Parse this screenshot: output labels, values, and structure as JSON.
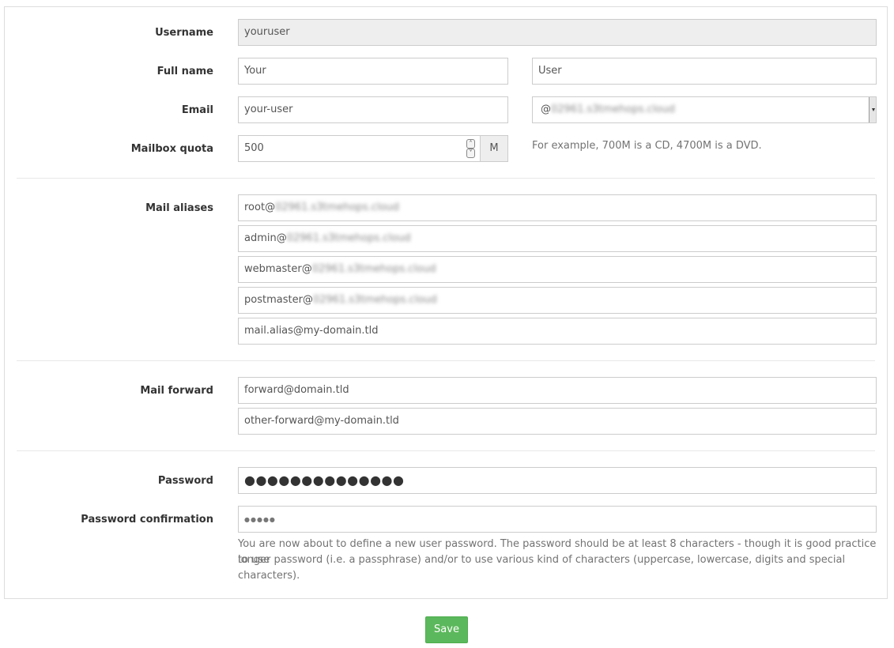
{
  "form": {
    "username": {
      "label": "Username",
      "value": "youruser"
    },
    "fullname": {
      "label": "Full name",
      "firstname": "Your",
      "lastname": "User"
    },
    "email": {
      "label": "Email",
      "localpart": "your-user",
      "domain_prefix": "@",
      "domain": "02961.s3tmehops.cloud"
    },
    "quota": {
      "label": "Mailbox quota",
      "value": "500",
      "unit": "M",
      "help": "For example, 700M is a CD, 4700M is a DVD."
    },
    "aliases": {
      "label": "Mail aliases",
      "items": [
        {
          "local": "root@",
          "domain": "02961.s3tmehops.cloud"
        },
        {
          "local": "admin@",
          "domain": "02961.s3tmehops.cloud"
        },
        {
          "local": "webmaster@",
          "domain": "02961.s3tmehops.cloud"
        },
        {
          "local": "postmaster@",
          "domain": "02961.s3tmehops.cloud"
        },
        {
          "local": "mail.alias@my-domain.tld",
          "domain": ""
        }
      ]
    },
    "forward": {
      "label": "Mail forward",
      "items": [
        "forward@domain.tld",
        "other-forward@my-domain.tld"
      ]
    },
    "password": {
      "label": "Password",
      "masked": "●●●●●●●●●●●●●●"
    },
    "password_confirm": {
      "label": "Password confirmation",
      "masked": "●●●●●",
      "help_line1": "You are now about to define a new user password. The password should be at least 8 characters - though it is good practice to use",
      "help_line2": "longer password (i.e. a passphrase) and/or to use various kind of characters (uppercase, lowercase, digits and special characters)."
    },
    "save_label": "Save"
  },
  "colors": {
    "save_button": "#5cb85c",
    "disabled_field": "#eeeeee",
    "border": "#cccccc"
  }
}
